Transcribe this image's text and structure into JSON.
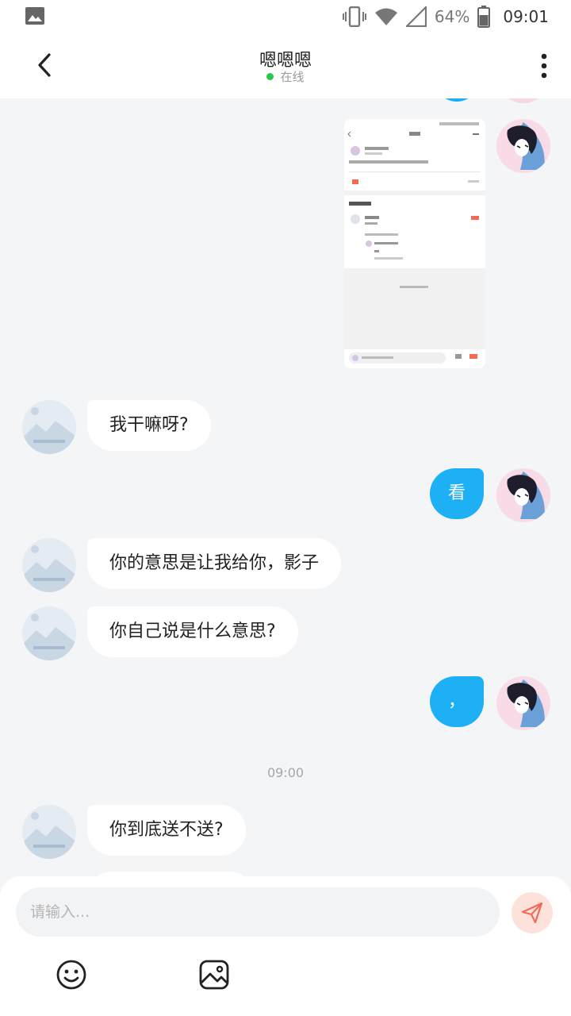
{
  "status_bar": {
    "battery": "64%",
    "time": "09:01"
  },
  "header": {
    "title": "嗯嗯嗯",
    "status": "在线"
  },
  "messages": [
    {
      "side": "right",
      "type": "image"
    },
    {
      "side": "left",
      "text": "我干嘛呀?"
    },
    {
      "side": "right",
      "text": "看"
    },
    {
      "side": "left",
      "text": "你的意思是让我给你，影子"
    },
    {
      "side": "left",
      "text": "你自己说是什么意思?"
    },
    {
      "side": "right",
      "text": "，"
    },
    {
      "timestamp": "09:00"
    },
    {
      "side": "left",
      "text": "你到底送不送?"
    }
  ],
  "composer": {
    "placeholder": "请输入..."
  },
  "colors": {
    "accent": "#1db0f5",
    "online": "#2cc64a",
    "send_bg": "#fde2dc",
    "send_icon": "#f26b55"
  },
  "icons": {
    "back": "chevron-left-icon",
    "more": "more-vertical-icon",
    "send": "send-icon",
    "emoji": "smiley-icon",
    "image": "image-icon"
  }
}
